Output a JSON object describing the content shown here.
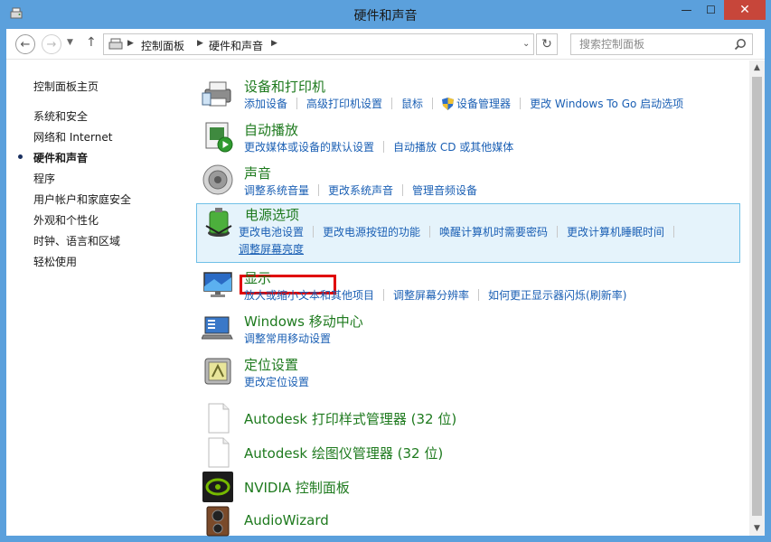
{
  "window": {
    "title": "硬件和声音",
    "controls": {
      "minimize": "—",
      "maximize": "☐",
      "close": "✕"
    }
  },
  "address_bar": {
    "breadcrumbs": [
      "控制面板",
      "硬件和声音"
    ],
    "search_placeholder": "搜索控制面板"
  },
  "sidebar": {
    "items": [
      {
        "label": "控制面板主页"
      },
      {
        "label": "系统和安全"
      },
      {
        "label": "网络和 Internet"
      },
      {
        "label": "硬件和声音",
        "current": true
      },
      {
        "label": "程序"
      },
      {
        "label": "用户帐户和家庭安全"
      },
      {
        "label": "外观和个性化"
      },
      {
        "label": "时钟、语言和区域"
      },
      {
        "label": "轻松使用"
      }
    ]
  },
  "categories": [
    {
      "title": "设备和打印机",
      "icon": "printer-icon",
      "links": [
        "添加设备",
        "高级打印机设置",
        "鼠标",
        "设备管理器",
        "更改 Windows To Go 启动选项"
      ]
    },
    {
      "title": "自动播放",
      "icon": "autoplay-icon",
      "links": [
        "更改媒体或设备的默认设置",
        "自动播放 CD 或其他媒体"
      ]
    },
    {
      "title": "声音",
      "icon": "speaker-icon",
      "links": [
        "调整系统音量",
        "更改系统声音",
        "管理音频设备"
      ]
    },
    {
      "title": "电源选项",
      "icon": "battery-icon",
      "links": [
        "更改电池设置",
        "更改电源按钮的功能",
        "唤醒计算机时需要密码",
        "更改计算机睡眠时间"
      ],
      "links2": [
        "调整屏幕亮度"
      ]
    },
    {
      "title": "显示",
      "icon": "display-icon",
      "links": [
        "放大或缩小文本和其他项目",
        "调整屏幕分辨率",
        "如何更正显示器闪烁(刷新率)"
      ]
    },
    {
      "title": "Windows 移动中心",
      "icon": "mobility-center-icon",
      "links": [
        "调整常用移动设置"
      ]
    },
    {
      "title": "定位设置",
      "icon": "location-icon",
      "links": [
        "更改定位设置"
      ]
    },
    {
      "title": "Autodesk 打印样式管理器 (32 位)",
      "icon": "file-icon",
      "links": []
    },
    {
      "title": "Autodesk 绘图仪管理器 (32 位)",
      "icon": "file-icon",
      "links": []
    },
    {
      "title": "NVIDIA 控制面板",
      "icon": "nvidia-icon",
      "links": []
    },
    {
      "title": "AudioWizard",
      "icon": "audiowizard-icon",
      "links": []
    }
  ]
}
